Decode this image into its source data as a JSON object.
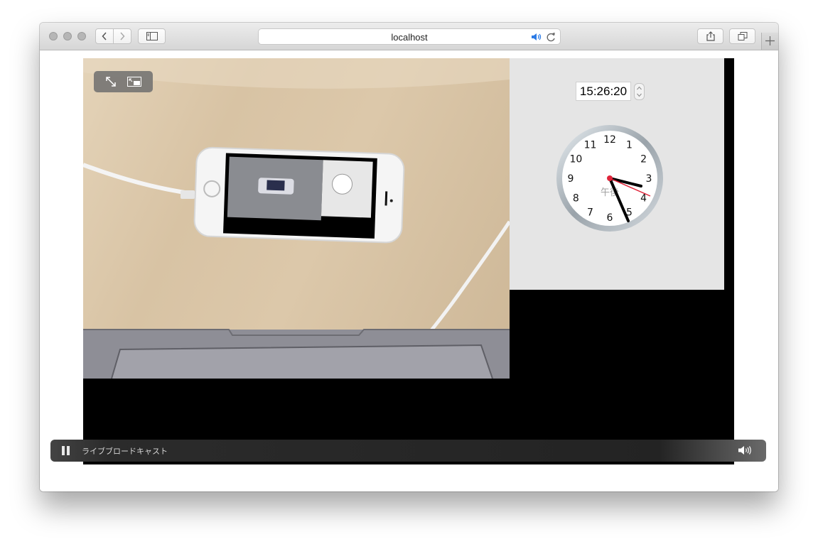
{
  "browser": {
    "url_text": "localhost",
    "buttons": [
      "back",
      "forward",
      "sidebar",
      "share",
      "tabs",
      "new-tab"
    ]
  },
  "video": {
    "time_display": "15:26:20",
    "clock": {
      "numbers": [
        "12",
        "1",
        "2",
        "3",
        "4",
        "5",
        "6",
        "7",
        "8",
        "9",
        "10",
        "11"
      ],
      "am_pm_label": "午後"
    },
    "control_bar": {
      "status_label": "ライブブロードキャスト"
    }
  }
}
